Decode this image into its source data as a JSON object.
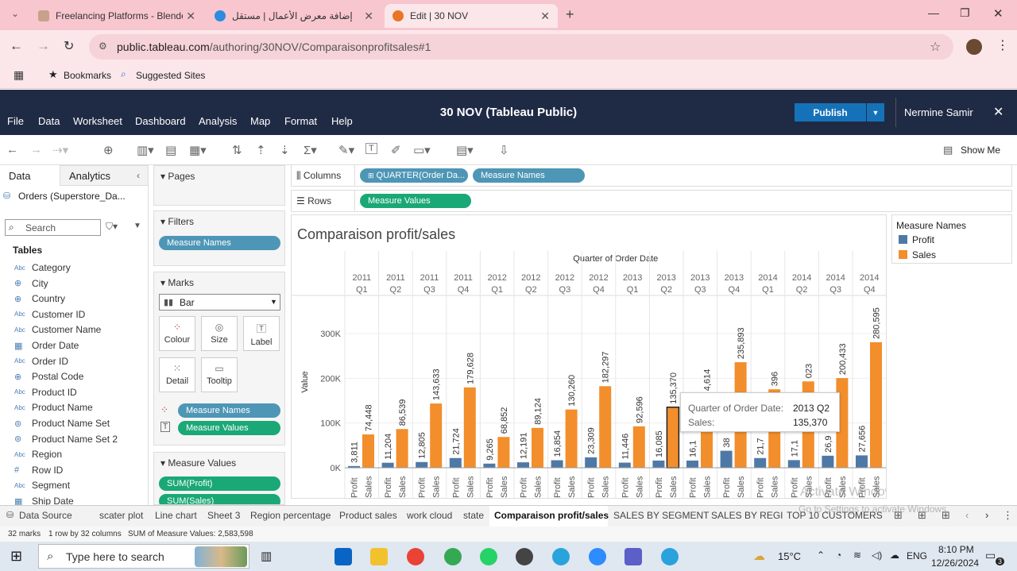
{
  "browser": {
    "tabs": [
      {
        "title": "Freelancing Platforms - Blende",
        "color": "#c8a18a"
      },
      {
        "title": "إضافة معرض الأعمال | مستقل",
        "color": "#2d8be0"
      },
      {
        "title": "Edit | 30 NOV",
        "color": "#e97627"
      }
    ],
    "url_host": "public.tableau.com",
    "url_path": "/authoring/30NOV/Comparaisonprofitsales#1",
    "bookmarks": [
      "Bookmarks",
      "Suggested Sites"
    ]
  },
  "tableau": {
    "menu": [
      "File",
      "Data",
      "Worksheet",
      "Dashboard",
      "Analysis",
      "Map",
      "Format",
      "Help"
    ],
    "doc_title": "30 NOV (Tableau Public)",
    "publish_label": "Publish",
    "user_name": "Nermine Samir",
    "show_me_label": "Show Me",
    "data_tab": "Data",
    "analytics_tab": "Analytics",
    "datasource": "Orders (Superstore_Da...",
    "search_placeholder": "Search",
    "tables_heading": "Tables",
    "fields": [
      {
        "name": "Category",
        "type": "Abc"
      },
      {
        "name": "City",
        "type": "geo"
      },
      {
        "name": "Country",
        "type": "geo"
      },
      {
        "name": "Customer ID",
        "type": "Abc"
      },
      {
        "name": "Customer Name",
        "type": "Abc"
      },
      {
        "name": "Order Date",
        "type": "date"
      },
      {
        "name": "Order ID",
        "type": "Abc"
      },
      {
        "name": "Postal Code",
        "type": "geo"
      },
      {
        "name": "Product ID",
        "type": "Abc"
      },
      {
        "name": "Product Name",
        "type": "Abc"
      },
      {
        "name": "Product Name Set",
        "type": "set"
      },
      {
        "name": "Product Name Set 2",
        "type": "set"
      },
      {
        "name": "Region",
        "type": "Abc"
      },
      {
        "name": "Row ID",
        "type": "#"
      },
      {
        "name": "Segment",
        "type": "Abc"
      },
      {
        "name": "Ship Date",
        "type": "date"
      }
    ],
    "pages_label": "Pages",
    "filters_label": "Filters",
    "filter_pill": "Measure Names",
    "marks_label": "Marks",
    "mark_type": "Bar",
    "mark_buttons": [
      "Colour",
      "Size",
      "Label",
      "Detail",
      "Tooltip"
    ],
    "marks_pills": [
      "Measure Names",
      "Measure Values"
    ],
    "measure_values_label": "Measure Values",
    "measure_value_pills": [
      "SUM(Profit)",
      "SUM(Sales)"
    ],
    "columns_label": "Columns",
    "rows_label": "Rows",
    "column_pills": [
      "QUARTER(Order Da...",
      "Measure Names"
    ],
    "row_pills": [
      "Measure Values"
    ],
    "legend_title": "Measure Names",
    "sheet_tabs": [
      "Data Source",
      "scater plot",
      "Line chart",
      "Sheet 3",
      "Region percentage",
      "Product sales",
      "work cloud",
      "state",
      "Comparaison profit/sales",
      "SALES BY SEGMENT",
      "SALES BY REGI",
      "TOP 10 CUSTOMERS"
    ],
    "status": {
      "marks": "32 marks",
      "rows_cols": "1 row by 32 columns",
      "sum": "SUM of Measure Values: 2,583,598"
    },
    "tooltip": {
      "date_label": "Quarter of Order Date:",
      "date_value": "2013 Q2",
      "sales_label": "Sales:",
      "sales_value": "135,370"
    },
    "watermark": "Activate Windows",
    "watermark_sub": "Go to Settings to activate Windows."
  },
  "taskbar": {
    "search_placeholder": "Type here to search",
    "temperature": "15°C",
    "lang": "ENG",
    "time": "8:10 PM",
    "date": "12/26/2024",
    "notif_count": "3"
  },
  "colors": {
    "profit": "#4e79a7",
    "sales": "#f28e2b",
    "header": "#1f2a44",
    "chrome_pink": "#f8c6cf",
    "publish": "#1672b8"
  },
  "chart_data": {
    "type": "bar",
    "title": "Comparaison profit/sales",
    "column_header": "Quarter of Order Date",
    "ylabel": "Value",
    "yticks": [
      "0K",
      "100K",
      "200K",
      "300K"
    ],
    "ylim": [
      0,
      330000
    ],
    "categories": [
      "2011 Q1",
      "2011 Q2",
      "2011 Q3",
      "2011 Q4",
      "2012 Q1",
      "2012 Q2",
      "2012 Q3",
      "2012 Q4",
      "2013 Q1",
      "2013 Q2",
      "2013 Q3",
      "2013 Q4",
      "2014 Q1",
      "2014 Q2",
      "2014 Q3",
      "2014 Q4"
    ],
    "year_labels": [
      "2011",
      "2011",
      "2011",
      "2011",
      "2012",
      "2012",
      "2012",
      "2012",
      "2013",
      "2013",
      "2013",
      "2013",
      "2014",
      "2014",
      "2014",
      "2014"
    ],
    "quarter_labels": [
      "Q1",
      "Q2",
      "Q3",
      "Q4",
      "Q1",
      "Q2",
      "Q3",
      "Q4",
      "Q1",
      "Q2",
      "Q3",
      "Q4",
      "Q1",
      "Q2",
      "Q3",
      "Q4"
    ],
    "series": [
      {
        "name": "Profit",
        "values": [
          3811,
          11204,
          12805,
          21724,
          9265,
          12191,
          16854,
          23309,
          11446,
          16085,
          16100,
          38000,
          21700,
          17100,
          26900,
          27656
        ],
        "labels": [
          "3,811",
          "11,204",
          "12,805",
          "21,724",
          "9,265",
          "12,191",
          "16,854",
          "23,309",
          "11,446",
          "16,085",
          "16,1",
          "38",
          "21,7",
          "17,1",
          "26,9",
          "27,656"
        ]
      },
      {
        "name": "Sales",
        "values": [
          74448,
          86539,
          143633,
          179628,
          68852,
          89124,
          130260,
          182297,
          92596,
          135370,
          164614,
          235893,
          175396,
          193023,
          200433,
          280595
        ],
        "labels": [
          "74,448",
          "86,539",
          "143,633",
          "179,628",
          "68,852",
          "89,124",
          "130,260",
          "182,297",
          "92,596",
          "135,370",
          "4,614",
          "235,893",
          "396",
          "023",
          "200,433",
          "280,595"
        ]
      }
    ],
    "legend": "top-right",
    "grid": true
  }
}
